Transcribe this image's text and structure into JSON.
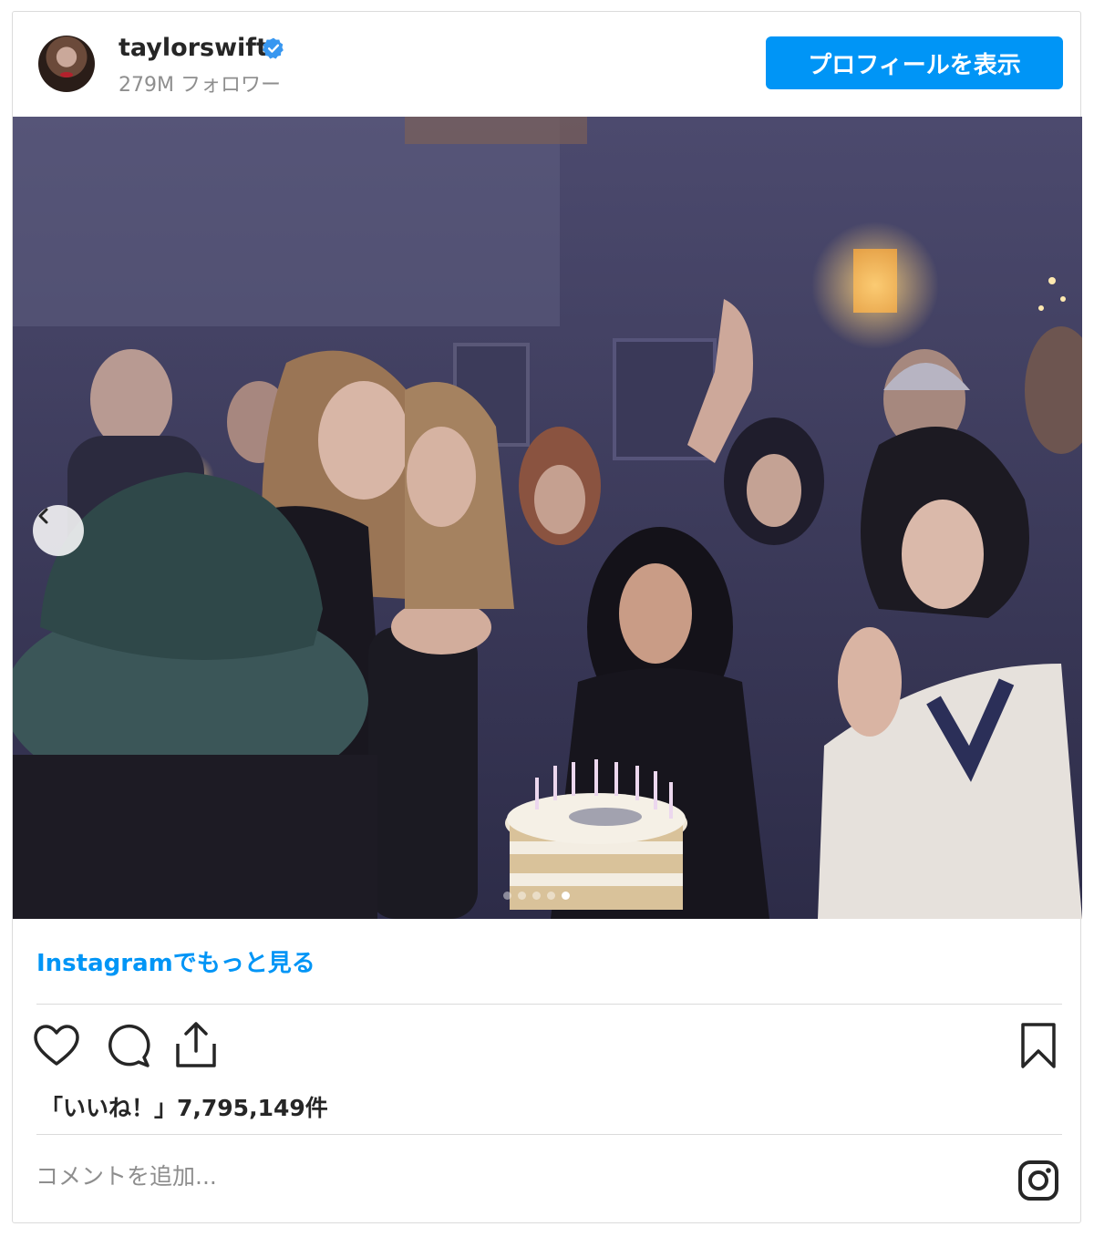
{
  "post": {
    "username": "taylorswift",
    "followers": "279M フォロワー",
    "profile_button": "プロフィールを表示",
    "verified_icon": "verified-badge-icon",
    "more_link": "Instagramでもっと見る",
    "likes": "「いいね！」7,795,149件",
    "comment_placeholder": "コメントを追加...",
    "carousel": {
      "total": 5,
      "active": 5
    }
  },
  "icons": {
    "like": "heart-icon",
    "comment": "comment-bubble-icon",
    "share": "share-icon",
    "save": "bookmark-icon",
    "prev": "chevron-left-icon",
    "brand": "instagram-icon"
  },
  "colors": {
    "accent": "#0095f6",
    "verified": "#3897f0",
    "text": "#262626",
    "muted": "#8e8e8e",
    "border": "#dbdbdb"
  }
}
